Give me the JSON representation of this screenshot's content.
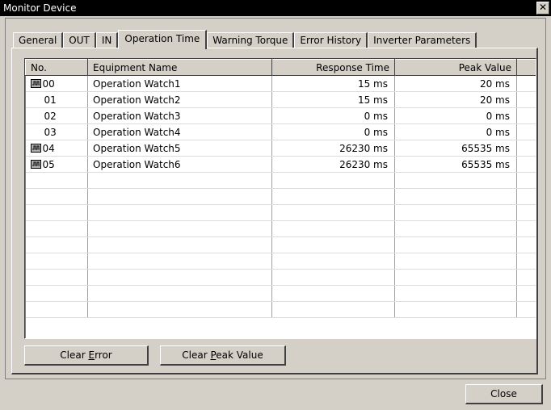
{
  "window": {
    "title": "Monitor Device",
    "close_glyph": "✕"
  },
  "tabs": [
    {
      "label": "General"
    },
    {
      "label": "OUT"
    },
    {
      "label": "IN"
    },
    {
      "label": "Operation Time",
      "active": true
    },
    {
      "label": "Warning Torque"
    },
    {
      "label": "Error History"
    },
    {
      "label": "Inverter Parameters"
    }
  ],
  "table": {
    "columns": [
      "No.",
      "Equipment Name",
      "Response Time",
      "Peak Value"
    ],
    "rows": [
      {
        "no": "00",
        "name": "Operation Watch1",
        "response": "15 ms",
        "peak": "20 ms",
        "icon": "waveform-icon"
      },
      {
        "no": "01",
        "name": "Operation Watch2",
        "response": "15 ms",
        "peak": "20 ms",
        "icon": ""
      },
      {
        "no": "02",
        "name": "Operation Watch3",
        "response": "0 ms",
        "peak": "0 ms",
        "icon": ""
      },
      {
        "no": "03",
        "name": "Operation Watch4",
        "response": "0 ms",
        "peak": "0 ms",
        "icon": ""
      },
      {
        "no": "04",
        "name": "Operation Watch5",
        "response": "26230 ms",
        "peak": "65535 ms",
        "icon": "waveform-icon"
      },
      {
        "no": "05",
        "name": "Operation Watch6",
        "response": "26230 ms",
        "peak": "65535 ms",
        "icon": "waveform-icon"
      }
    ]
  },
  "buttons": {
    "clear_error_pre": "Clear ",
    "clear_error_key": "E",
    "clear_error_post": "rror",
    "clear_peak_pre": "Clear ",
    "clear_peak_key": "P",
    "clear_peak_post": "eak Value",
    "close": "Close"
  }
}
